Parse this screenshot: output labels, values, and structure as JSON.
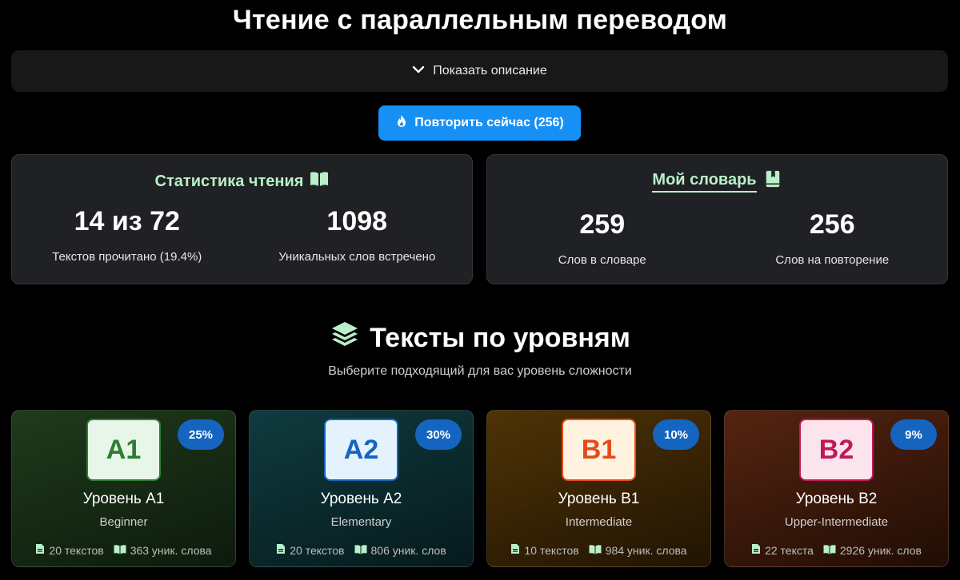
{
  "page": {
    "title": "Чтение с параллельным переводом"
  },
  "description_toggle": {
    "label": "Показать описание",
    "icon": "chevron-down-icon"
  },
  "repeat_button": {
    "label": "Повторить сейчас (256)",
    "icon": "fire-icon"
  },
  "reading_stats": {
    "title": "Статистика чтения",
    "icon": "book-open-icon",
    "items": [
      {
        "value": "14 из 72",
        "label": "Текстов прочитано (19.4%)"
      },
      {
        "value": "1098",
        "label": "Уникальных слов встречено"
      }
    ]
  },
  "dictionary": {
    "title": "Мой словарь",
    "icon": "book-bookmark-icon",
    "items": [
      {
        "value": "259",
        "label": "Слов в словаре"
      },
      {
        "value": "256",
        "label": "Слов на повторение"
      }
    ]
  },
  "levels_section": {
    "title": "Тексты по уровням",
    "icon": "layers-icon",
    "subtitle": "Выберите подходящий для вас уровень сложности"
  },
  "levels": [
    {
      "code": "A1",
      "percent": "25%",
      "name": "Уровень A1",
      "description": "Beginner",
      "texts": "20 текстов",
      "words": "363 уник. слова",
      "color": "#2e7d32"
    },
    {
      "code": "A2",
      "percent": "30%",
      "name": "Уровень A2",
      "description": "Elementary",
      "texts": "20 текстов",
      "words": "806 уник. слов",
      "color": "#1565c0"
    },
    {
      "code": "B1",
      "percent": "10%",
      "name": "Уровень B1",
      "description": "Intermediate",
      "texts": "10 текстов",
      "words": "984 уник. слова",
      "color": "#e64a19"
    },
    {
      "code": "B2",
      "percent": "9%",
      "name": "Уровень B2",
      "description": "Upper-Intermediate",
      "texts": "22 текста",
      "words": "2926 уник. слов",
      "color": "#c2185b"
    }
  ],
  "colors": {
    "accent_blue": "#1690f5",
    "stat_title_green": "#b8f0c8",
    "badge_blue": "#1565c0"
  }
}
